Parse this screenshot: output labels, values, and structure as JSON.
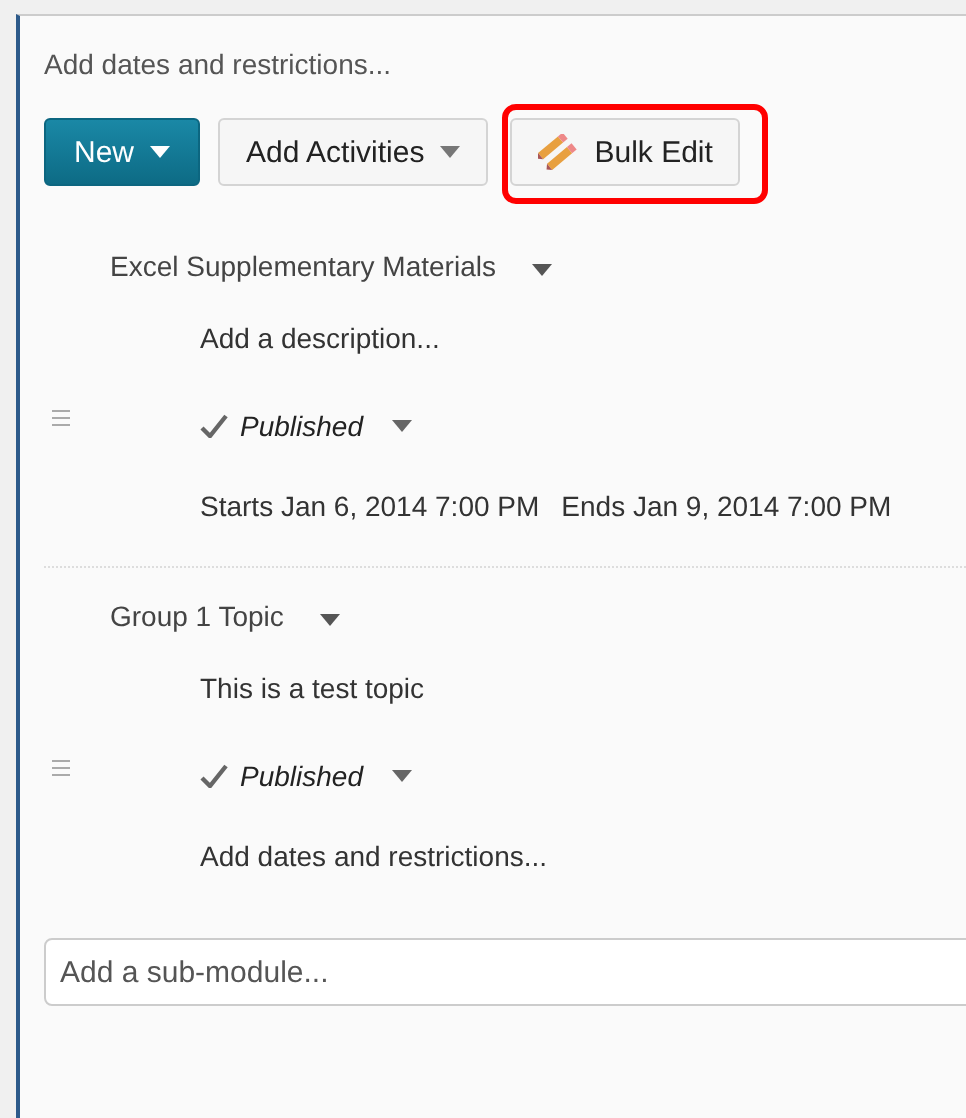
{
  "header_link": "Add dates and restrictions...",
  "toolbar": [
    {
      "label": "New",
      "kind": "primary",
      "dropdown": true,
      "highlighted": false
    },
    {
      "label": "Add Activities",
      "kind": "default",
      "dropdown": true,
      "highlighted": false
    },
    {
      "label": "Bulk Edit",
      "kind": "pencils",
      "dropdown": false,
      "highlighted": true
    }
  ],
  "topics": [
    {
      "title": "Excel Supplementary Materials",
      "description": "Add a description...",
      "status": {
        "label": "Published",
        "published": true
      },
      "dates": {
        "starts": "Starts Jan 6, 2014 7:00 PM",
        "ends": "Ends Jan 9, 2014 7:00 PM"
      }
    },
    {
      "title": "Group 1 Topic",
      "description": "This is a test topic",
      "status": {
        "label": "Published",
        "published": true
      },
      "dates_link": "Add dates and restrictions..."
    }
  ],
  "sub_module": {
    "placeholder": "Add a sub-module..."
  }
}
